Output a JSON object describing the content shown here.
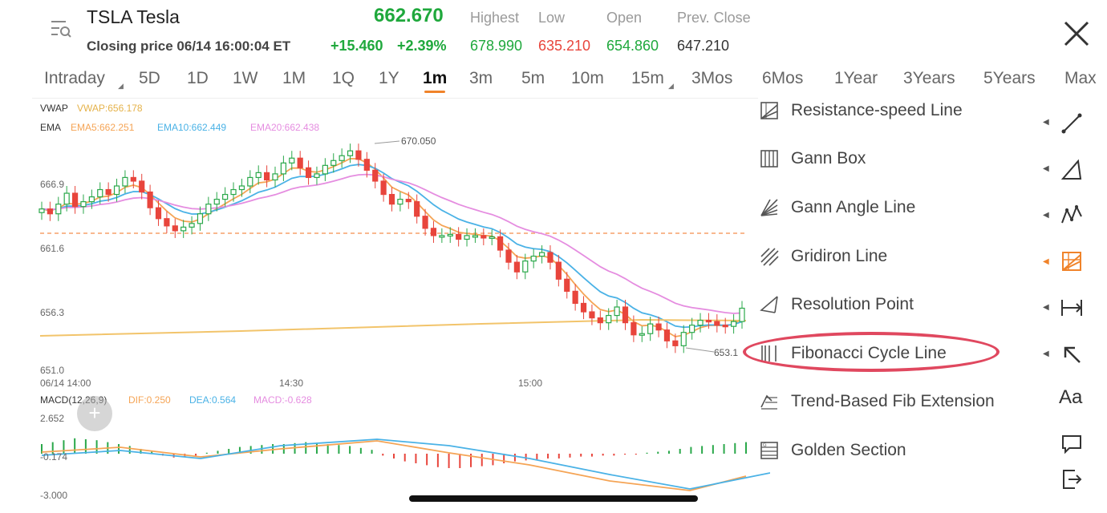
{
  "header": {
    "ticker": "TSLA Tesla",
    "last_price": "662.670",
    "closing_info": "Closing price 06/14 16:00:04 ET",
    "change_abs": "+15.460",
    "change_pct": "+2.39%",
    "labels": {
      "highest": "Highest",
      "low": "Low",
      "open": "Open",
      "prev_close": "Prev. Close"
    },
    "values": {
      "highest": "678.990",
      "low": "635.210",
      "open": "654.860",
      "prev_close": "647.210"
    },
    "colors": {
      "up": "#1fa83c",
      "down": "#e8453c",
      "neutral": "#333333"
    }
  },
  "timeframes": [
    "Intraday",
    "5D",
    "1D",
    "1W",
    "1M",
    "1Q",
    "1Y",
    "1m",
    "3m",
    "5m",
    "10m",
    "15m",
    "3Mos",
    "6Mos",
    "1Year",
    "3Years",
    "5Years",
    "Max"
  ],
  "selected_timeframe": "1m",
  "main_chart": {
    "vwap_label": "VWAP",
    "vwap_value": "VWAP:656.178",
    "ema_label": "EMA",
    "ema5": "EMA5:662.251",
    "ema10": "EMA10:662.449",
    "ema20": "EMA20:662.438",
    "y_ticks": [
      "666.9",
      "661.6",
      "656.3",
      "651.0"
    ],
    "x_ticks": [
      "06/14 14:00",
      "14:30",
      "15:00"
    ],
    "high_marker": "670.050",
    "low_marker": "653.1",
    "colors": {
      "up": "#2aa84a",
      "down": "#e8453c",
      "vwap": "#f2c46b",
      "ema5": "#f5a455",
      "ema10": "#4ab2e6",
      "ema20": "#e58de0"
    }
  },
  "macd": {
    "label": "MACD(12,26,9)",
    "dif": "DIF:0.250",
    "dea": "DEA:0.564",
    "macd": "MACD:-0.628",
    "y_ticks": [
      "2.652",
      "-0.174",
      "-3.000"
    ]
  },
  "tools_panel": {
    "items": [
      {
        "label": "Resistance-speed Line",
        "icon": "resistance-speed-icon"
      },
      {
        "label": "Gann Box",
        "icon": "gann-box-icon"
      },
      {
        "label": "Gann Angle Line",
        "icon": "gann-angle-icon"
      },
      {
        "label": "Gridiron Line",
        "icon": "gridiron-icon"
      },
      {
        "label": "Resolution Point",
        "icon": "resolution-point-icon"
      },
      {
        "label": "Fibonacci Cycle Line",
        "icon": "fibonacci-cycle-icon"
      },
      {
        "label": "Trend-Based Fib Extension",
        "icon": "trend-fib-extension-icon"
      },
      {
        "label": "Golden Section",
        "icon": "golden-section-icon"
      }
    ],
    "highlighted": "Fibonacci Cycle Line",
    "highlight_color": "#e0485f"
  },
  "tool_rail": {
    "text_tool_label": "Aa",
    "icons": [
      "line-tool-icon",
      "triangle-tool-icon",
      "pattern-tool-icon",
      "fib-grid-tool-icon",
      "measure-tool-icon",
      "arrow-tool-icon",
      "text-tool-icon",
      "comment-tool-icon",
      "exit-tool-icon"
    ],
    "active_color": "#f0832a"
  },
  "plus_button": "+"
}
